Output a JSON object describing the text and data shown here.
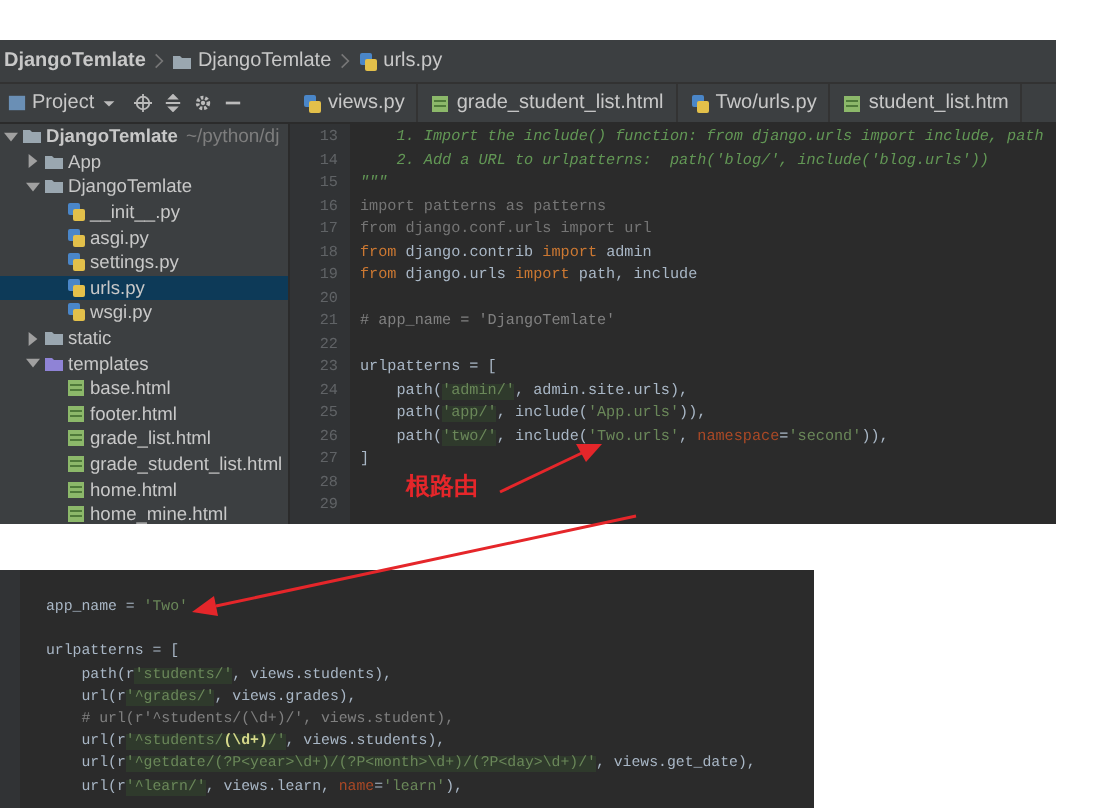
{
  "breadcrumbs": [
    {
      "label": "DjangoTemlate",
      "kind": "project"
    },
    {
      "label": "DjangoTemlate",
      "kind": "folder"
    },
    {
      "label": "urls.py",
      "kind": "python"
    }
  ],
  "project_tool": {
    "label": "Project"
  },
  "tabs": [
    {
      "label": "views.py",
      "kind": "python",
      "selected": false
    },
    {
      "label": "grade_student_list.html",
      "kind": "html",
      "selected": false
    },
    {
      "label": "Two/urls.py",
      "kind": "python",
      "selected": false
    },
    {
      "label": "student_list.htm",
      "kind": "html",
      "selected": false
    }
  ],
  "tree": {
    "label": "DjangoTemlate",
    "path": "~/python/dj",
    "kind": "folder",
    "expanded": true,
    "selected": false,
    "children": [
      {
        "label": "App",
        "kind": "folder",
        "expanded": false,
        "selected": false
      },
      {
        "label": "DjangoTemlate",
        "kind": "folder",
        "expanded": true,
        "selected": false,
        "children": [
          {
            "label": "__init__.py",
            "kind": "python",
            "selected": false
          },
          {
            "label": "asgi.py",
            "kind": "python",
            "selected": false
          },
          {
            "label": "settings.py",
            "kind": "python",
            "selected": false
          },
          {
            "label": "urls.py",
            "kind": "python",
            "selected": true
          },
          {
            "label": "wsgi.py",
            "kind": "python",
            "selected": false
          }
        ]
      },
      {
        "label": "static",
        "kind": "folder",
        "expanded": false,
        "selected": false
      },
      {
        "label": "templates",
        "kind": "template_folder",
        "expanded": true,
        "selected": false,
        "children": [
          {
            "label": "base.html",
            "kind": "html",
            "selected": false
          },
          {
            "label": "footer.html",
            "kind": "html",
            "selected": false
          },
          {
            "label": "grade_list.html",
            "kind": "html",
            "selected": false
          },
          {
            "label": "grade_student_list.html",
            "kind": "html",
            "selected": false
          },
          {
            "label": "home.html",
            "kind": "html",
            "selected": false
          },
          {
            "label": "home_mine.html",
            "kind": "html",
            "selected": false
          }
        ]
      }
    ]
  },
  "editor": {
    "lines": [
      {
        "number": "13",
        "kind": "code",
        "segments": [
          {
            "text": "    1. Import the include() function: from django.urls import include, path",
            "kind": "doc"
          }
        ]
      },
      {
        "number": "14",
        "kind": "code",
        "segments": [
          {
            "text": "    2. Add a URL to urlpatterns:  path('blog/', include('blog.urls'))",
            "kind": "doc"
          }
        ]
      },
      {
        "number": "15",
        "kind": "code",
        "segments": [
          {
            "text": "\"\"\"",
            "kind": "doc"
          }
        ]
      },
      {
        "number": "16",
        "kind": "code",
        "segments": [
          {
            "text": "import patterns as patterns",
            "kind": "unused"
          }
        ]
      },
      {
        "number": "17",
        "kind": "code",
        "segments": [
          {
            "text": "from django.conf.urls import url",
            "kind": "unused"
          }
        ]
      },
      {
        "number": "18",
        "kind": "code",
        "segments": [
          {
            "text": "from ",
            "kind": "keyword"
          },
          {
            "text": "django.contrib ",
            "kind": "plain"
          },
          {
            "text": "import ",
            "kind": "keyword"
          },
          {
            "text": "admin",
            "kind": "plain"
          }
        ]
      },
      {
        "number": "19",
        "kind": "code",
        "segments": [
          {
            "text": "from ",
            "kind": "keyword"
          },
          {
            "text": "django.urls ",
            "kind": "plain"
          },
          {
            "text": "import ",
            "kind": "keyword"
          },
          {
            "text": "path, include",
            "kind": "plain"
          }
        ]
      },
      {
        "number": "20",
        "kind": "blank"
      },
      {
        "number": "21",
        "kind": "code",
        "segments": [
          {
            "text": "# app_name = 'DjangoTemlate'",
            "kind": "comment"
          }
        ]
      },
      {
        "number": "22",
        "kind": "blank"
      },
      {
        "number": "23",
        "kind": "code",
        "segments": [
          {
            "text": "urlpatterns = [",
            "kind": "plain"
          }
        ]
      },
      {
        "number": "24",
        "kind": "code",
        "segments": [
          {
            "text": "    path(",
            "kind": "plain"
          },
          {
            "text": "'admin/'",
            "kind": "regex"
          },
          {
            "text": ", admin.site.urls),",
            "kind": "plain"
          }
        ]
      },
      {
        "number": "25",
        "kind": "code",
        "segments": [
          {
            "text": "    path(",
            "kind": "plain"
          },
          {
            "text": "'app/'",
            "kind": "regex"
          },
          {
            "text": ", include(",
            "kind": "plain"
          },
          {
            "text": "'App.urls'",
            "kind": "string"
          },
          {
            "text": ")),",
            "kind": "plain"
          }
        ]
      },
      {
        "number": "26",
        "kind": "code",
        "segments": [
          {
            "text": "    path(",
            "kind": "plain"
          },
          {
            "text": "'two/'",
            "kind": "regex"
          },
          {
            "text": ", include(",
            "kind": "plain"
          },
          {
            "text": "'Two.urls'",
            "kind": "string"
          },
          {
            "text": ", ",
            "kind": "plain"
          },
          {
            "text": "namespace",
            "kind": "param"
          },
          {
            "text": "=",
            "kind": "plain"
          },
          {
            "text": "'second'",
            "kind": "string"
          },
          {
            "text": ")),",
            "kind": "plain"
          }
        ]
      },
      {
        "number": "27",
        "kind": "code",
        "segments": [
          {
            "text": "]",
            "kind": "plain"
          }
        ]
      },
      {
        "number": "28",
        "kind": "blank"
      },
      {
        "number": "29",
        "kind": "blank"
      }
    ]
  },
  "annotation": {
    "text": "根路由"
  },
  "second_editor": {
    "lines": [
      {
        "kind": "code",
        "segments": [
          {
            "text": "app_name = ",
            "kind": "plain"
          },
          {
            "text": "'Two'",
            "kind": "string"
          }
        ]
      },
      {
        "kind": "blank"
      },
      {
        "kind": "code",
        "segments": [
          {
            "text": "urlpatterns = [",
            "kind": "plain"
          }
        ]
      },
      {
        "kind": "code",
        "segments": [
          {
            "text": "    path(r",
            "kind": "plain"
          },
          {
            "text": "'students/'",
            "kind": "regex"
          },
          {
            "text": ", views.students),",
            "kind": "plain"
          }
        ]
      },
      {
        "kind": "code",
        "segments": [
          {
            "text": "    url(r",
            "kind": "plain"
          },
          {
            "text": "'^grades/'",
            "kind": "regex"
          },
          {
            "text": ", views.grades),",
            "kind": "plain"
          }
        ]
      },
      {
        "kind": "code",
        "segments": [
          {
            "text": "    # url(r'^students/(\\d+)/', views.student),",
            "kind": "comment"
          }
        ]
      },
      {
        "kind": "code",
        "segments": [
          {
            "text": "    url(r",
            "kind": "plain"
          },
          {
            "text": "'^students/",
            "kind": "regex"
          },
          {
            "text": "(\\d+)",
            "kind": "escape"
          },
          {
            "text": "/'",
            "kind": "regex"
          },
          {
            "text": ", views.students),",
            "kind": "plain"
          }
        ]
      },
      {
        "kind": "code",
        "segments": [
          {
            "text": "    url(r",
            "kind": "plain"
          },
          {
            "text": "'^getdate/(?P<year>\\d+)/(?P<month>\\d+)/(?P<day>\\d+)/'",
            "kind": "regex"
          },
          {
            "text": ", views.get_date),",
            "kind": "plain"
          }
        ]
      },
      {
        "kind": "code",
        "segments": [
          {
            "text": "    url(r",
            "kind": "plain"
          },
          {
            "text": "'^learn/'",
            "kind": "regex"
          },
          {
            "text": ", views.learn, ",
            "kind": "plain"
          },
          {
            "text": "name",
            "kind": "param"
          },
          {
            "text": "=",
            "kind": "plain"
          },
          {
            "text": "'learn'",
            "kind": "string"
          },
          {
            "text": "),",
            "kind": "plain"
          }
        ]
      }
    ]
  }
}
